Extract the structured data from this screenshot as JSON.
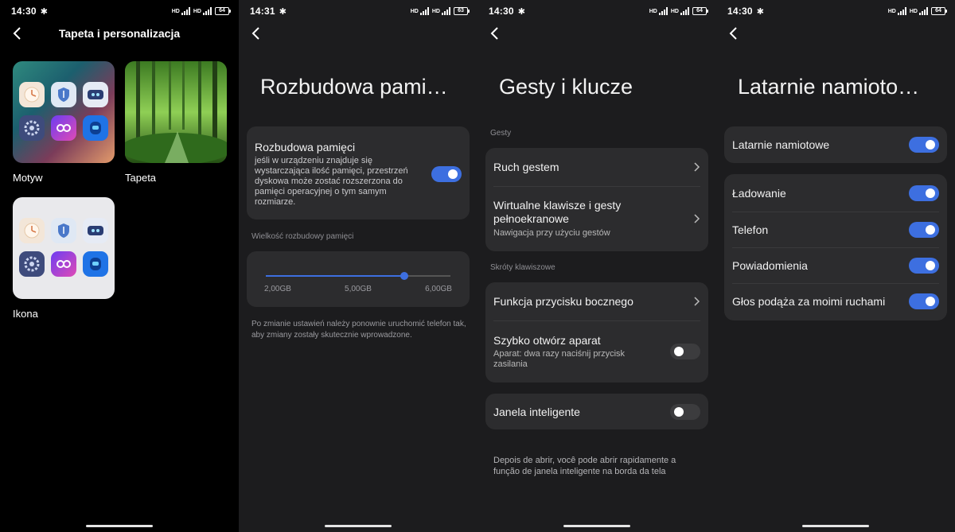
{
  "colors": {
    "accent": "#3d6fe0",
    "card": "#2c2c2e",
    "background": "#1c1c1e"
  },
  "screen1": {
    "time": "14:30",
    "battery": "64",
    "title": "Tapeta i personalizacja",
    "tiles": {
      "theme": "Motyw",
      "wallpaper": "Tapeta",
      "icon": "Ikona"
    }
  },
  "screen2": {
    "time": "14:31",
    "battery": "63",
    "title": "Rozbudowa pami…",
    "toggle_label": "Rozbudowa pamięci",
    "toggle_desc": "jeśli w urządzeniu znajduje się wystarczająca ilość pamięci, przestrzeń dyskowa może zostać rozszerzona do pamięci operacyjnej o tym samym rozmiarze.",
    "toggle_on": true,
    "section": "Wielkość rozbudowy pamięci",
    "slider": {
      "min": "2,00GB",
      "mid": "5,00GB",
      "max": "6,00GB",
      "value_fraction": 0.75
    },
    "note": "Po zmianie ustawień należy ponownie uruchomić telefon tak, aby zmiany zostały skutecznie wprowadzone."
  },
  "screen3": {
    "time": "14:30",
    "battery": "64",
    "title": "Gesty i klucze",
    "section_gestures": "Gesty",
    "gesture_motion": "Ruch gestem",
    "virtual_keys": "Wirtualne klawisze i gesty pełnoekranowe",
    "virtual_keys_sub": "Nawigacja przy użyciu gestów",
    "section_shortcuts": "Skróty klawiszowe",
    "side_button": "Funkcja przycisku bocznego",
    "quick_camera": "Szybko otwórz aparat",
    "quick_camera_sub": "Aparat: dwa razy naciśnij przycisk zasilania",
    "quick_camera_on": false,
    "smart_window": "Janela inteligente",
    "smart_window_on": false,
    "note": "Depois de abrir, você pode abrir rapidamente a função de janela inteligente na borda da tela"
  },
  "screen4": {
    "time": "14:30",
    "battery": "64",
    "title": "Latarnie namioto…",
    "main_toggle": "Latarnie namiotowe",
    "items": [
      {
        "label": "Ładowanie",
        "on": true
      },
      {
        "label": "Telefon",
        "on": true
      },
      {
        "label": "Powiadomienia",
        "on": true
      },
      {
        "label": "Głos podąża za moimi ruchami",
        "on": true
      }
    ]
  }
}
